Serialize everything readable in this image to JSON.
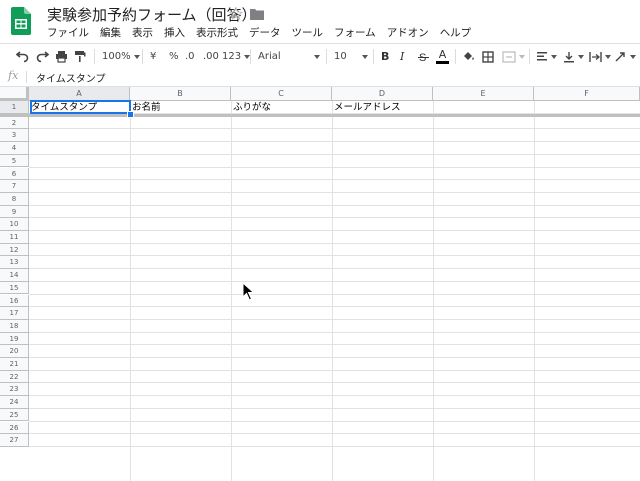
{
  "doc": {
    "title": "実験参加予約フォーム（回答）"
  },
  "menu": [
    "ファイル",
    "編集",
    "表示",
    "挿入",
    "表示形式",
    "データ",
    "ツール",
    "フォーム",
    "アドオン",
    "ヘルプ"
  ],
  "toolbar": {
    "zoom": "100%",
    "currency": "¥",
    "percent": "%",
    "dec_decrease": ".0",
    "dec_increase": ".00",
    "more_formats": "123",
    "font": "Arial",
    "font_size": "10",
    "bold": "B",
    "italic": "I",
    "text_color_label": "A"
  },
  "formula_bar": {
    "fx": "fx",
    "content": "タイムスタンプ"
  },
  "columns": [
    "A",
    "B",
    "C",
    "D",
    "E",
    "F"
  ],
  "rows": [
    "1",
    "2",
    "3",
    "4",
    "5",
    "6",
    "7",
    "8",
    "9",
    "10",
    "11",
    "12",
    "13",
    "14",
    "15",
    "16",
    "17",
    "18",
    "19",
    "20",
    "21",
    "22",
    "23",
    "24",
    "25",
    "26",
    "27"
  ],
  "header_row": [
    "タイムスタンプ",
    "お名前",
    "ふりがな",
    "メールアドレス",
    "",
    ""
  ],
  "colors": {
    "sheets_green": "#0f9d58",
    "selection": "#1a73e8",
    "header_bg": "#f8f9fa"
  }
}
